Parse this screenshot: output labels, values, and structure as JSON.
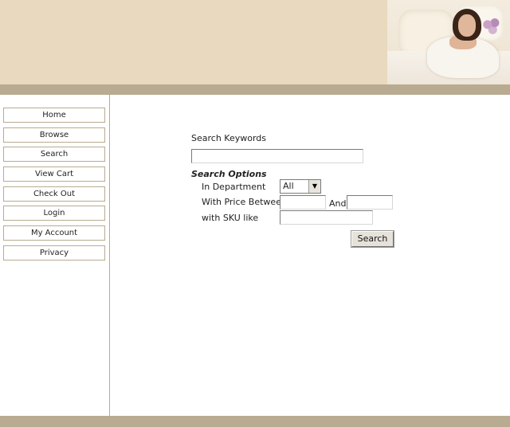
{
  "header": {
    "hero_image": "woman-in-bed-photo"
  },
  "sidebar": {
    "items": [
      {
        "label": "Home"
      },
      {
        "label": "Browse"
      },
      {
        "label": "Search"
      },
      {
        "label": "View Cart"
      },
      {
        "label": "Check Out"
      },
      {
        "label": "Login"
      },
      {
        "label": "My Account"
      },
      {
        "label": "Privacy"
      }
    ]
  },
  "search": {
    "keywords_label": "Search Keywords",
    "keywords_value": "",
    "options_heading": "Search Options",
    "department_label": "In Department",
    "department_selected": "All",
    "price_label": "With Price Between",
    "price_min": "",
    "price_and_label": "And",
    "price_max": "",
    "sku_label": "with SKU like",
    "sku_value": "",
    "submit_label": "Search"
  },
  "colors": {
    "header_bg": "#e8d9bf",
    "band": "#b8ab91"
  }
}
